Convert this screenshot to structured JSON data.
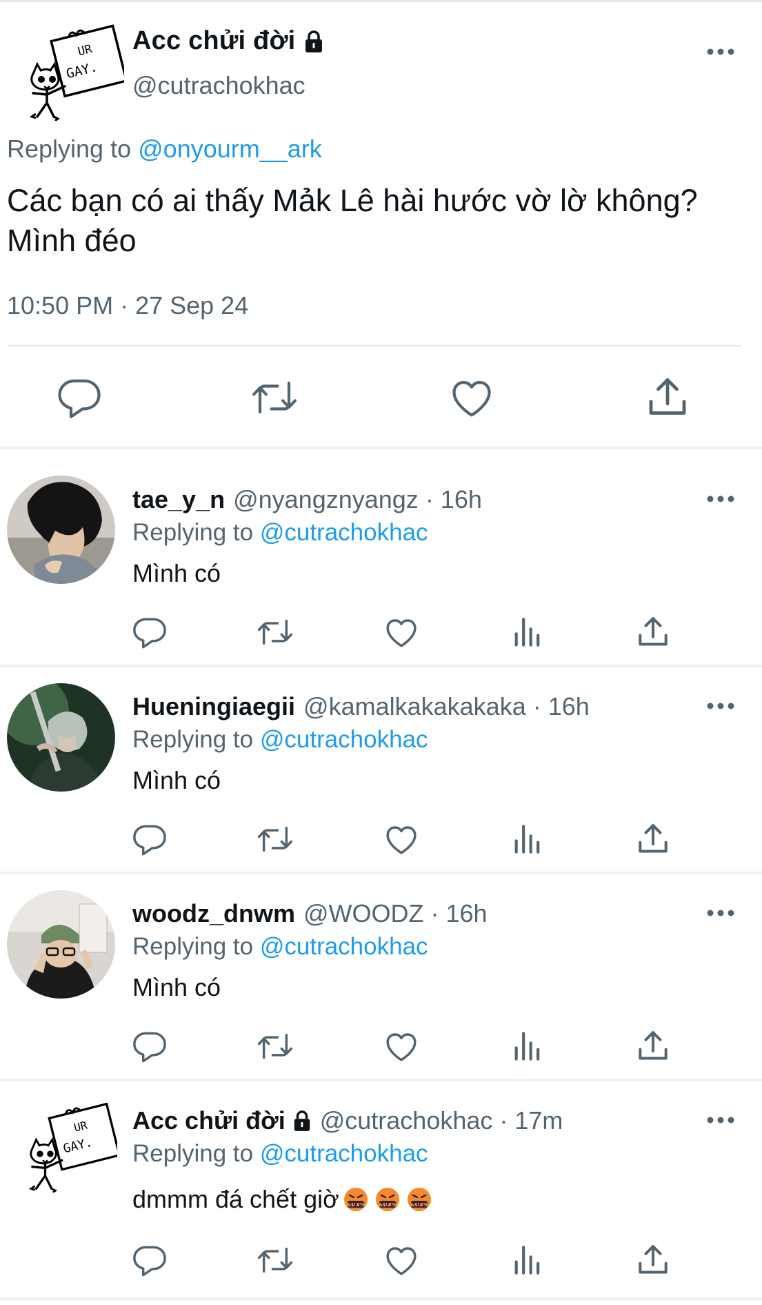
{
  "main_tweet": {
    "display_name": "Acc chửi đời",
    "handle": "@cutrachokhac",
    "replying_prefix": "Replying to",
    "replying_to": "@onyourm__ark",
    "text": "Các bạn có ai thấy Mảk Lê hài hước vờ lờ không? Mình đéo",
    "timestamp": "10:50 PM · 27 Sep 24",
    "avatar_text": [
      "UR",
      "GAY."
    ]
  },
  "replies": [
    {
      "display_name": "tae_y_n",
      "handle": "@nyangznyangz",
      "time": "· 16h",
      "replying_prefix": "Replying to",
      "replying_to": "@cutrachokhac",
      "text": "Mình có"
    },
    {
      "display_name": "Hueningiaegii",
      "handle": "@kamalkakakakaka",
      "time": "· 16h",
      "replying_prefix": "Replying to",
      "replying_to": "@cutrachokhac",
      "text": "Mình có"
    },
    {
      "display_name": "woodz_dnwm",
      "handle": "@WOODZ",
      "time": "· 16h",
      "replying_prefix": "Replying to",
      "replying_to": "@cutrachokhac",
      "text": "Mình có"
    },
    {
      "display_name": "Acc chửi đời",
      "handle": "@cutrachokhac",
      "time": "· 17m",
      "replying_prefix": "Replying to",
      "replying_to": "@cutrachokhac",
      "text": "dmmm đá chết giờ",
      "emoji_text": "&$!#%",
      "avatar_text": [
        "UR",
        "GAY."
      ]
    }
  ],
  "icons": {
    "reply": "reply-icon",
    "retweet": "retweet-icon",
    "like": "like-icon",
    "views": "views-icon",
    "share": "share-icon",
    "more": "more-icon",
    "lock": "lock-icon"
  },
  "colors": {
    "text": "#0f1419",
    "secondary": "#536471",
    "mention": "#1d9bf0",
    "icon": "#536471",
    "divider": "#e6e9ec"
  }
}
